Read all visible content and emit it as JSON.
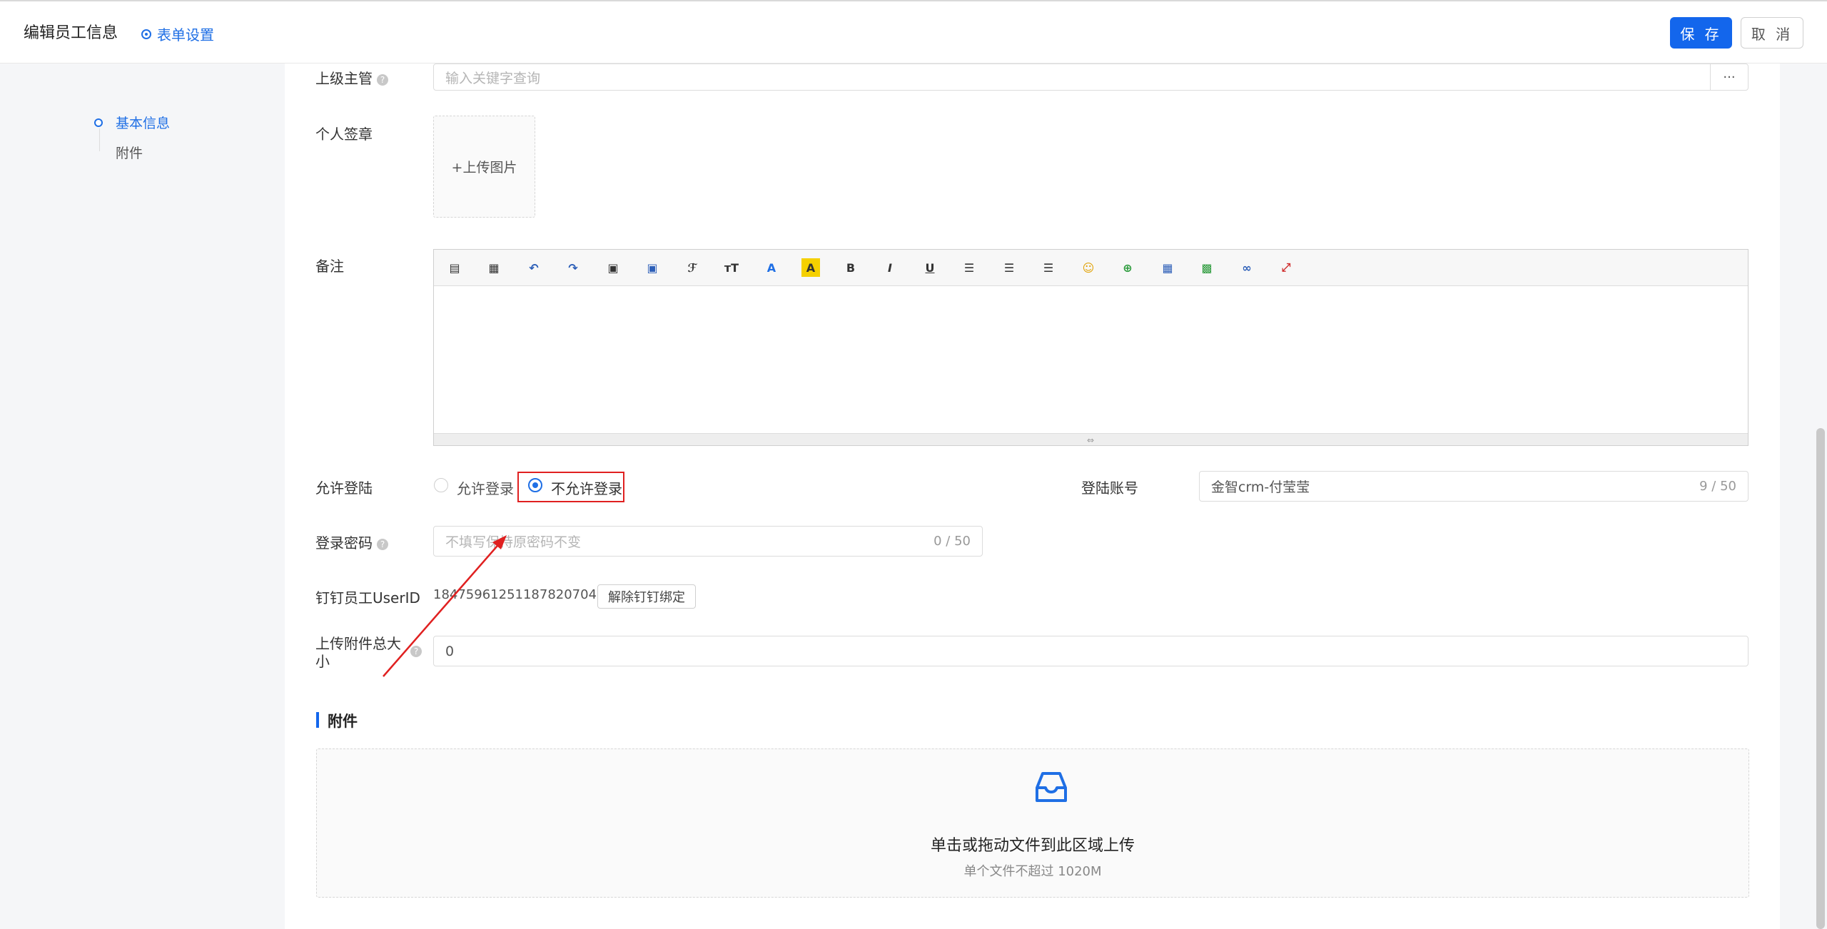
{
  "header": {
    "title": "编辑员工信息",
    "form_settings": "表单设置",
    "save": "保 存",
    "cancel": "取 消"
  },
  "sidenav": {
    "items": [
      {
        "label": "基本信息",
        "active": true
      },
      {
        "label": "附件",
        "active": false
      }
    ]
  },
  "form": {
    "supervisor": {
      "label": "上级主管",
      "placeholder": "输入关键字查询",
      "more": "···"
    },
    "signature": {
      "label": "个人签章",
      "upload": "+上传图片"
    },
    "remark": {
      "label": "备注"
    },
    "allow_login": {
      "label": "允许登陆",
      "options": [
        {
          "label": "允许登录",
          "checked": false
        },
        {
          "label": "不允许登录",
          "checked": true
        }
      ]
    },
    "login_account": {
      "label": "登陆账号",
      "value": "金智crm-付莹莹",
      "counter": "9 / 50"
    },
    "password": {
      "label": "登录密码",
      "placeholder": "不填写保持原密码不变",
      "counter": "0 / 50"
    },
    "dingtalk": {
      "label": "钉钉员工UserID",
      "value": "18475961251187820704",
      "unbind": "解除钉钉绑定"
    },
    "attachment_size": {
      "label": "上传附件总大小",
      "value": "0"
    }
  },
  "attachments": {
    "section_title": "附件",
    "drop_text": "单击或拖动文件到此区域上传",
    "drop_hint": "单个文件不超过 1020M"
  },
  "toolbar_icons": [
    "source-icon",
    "preview-icon",
    "undo-icon",
    "redo-icon",
    "paste-icon",
    "paste-text-icon",
    "font-family-icon",
    "font-size-icon",
    "font-color-icon",
    "highlight-icon",
    "bold-icon",
    "italic-icon",
    "underline-icon",
    "align-left-icon",
    "align-center-icon",
    "align-right-icon",
    "emoji-icon",
    "insert-row-icon",
    "table-icon",
    "image-icon",
    "link-icon",
    "fullscreen-icon"
  ],
  "colors": {
    "accent": "#1366ec",
    "annotation": "#e02020"
  }
}
